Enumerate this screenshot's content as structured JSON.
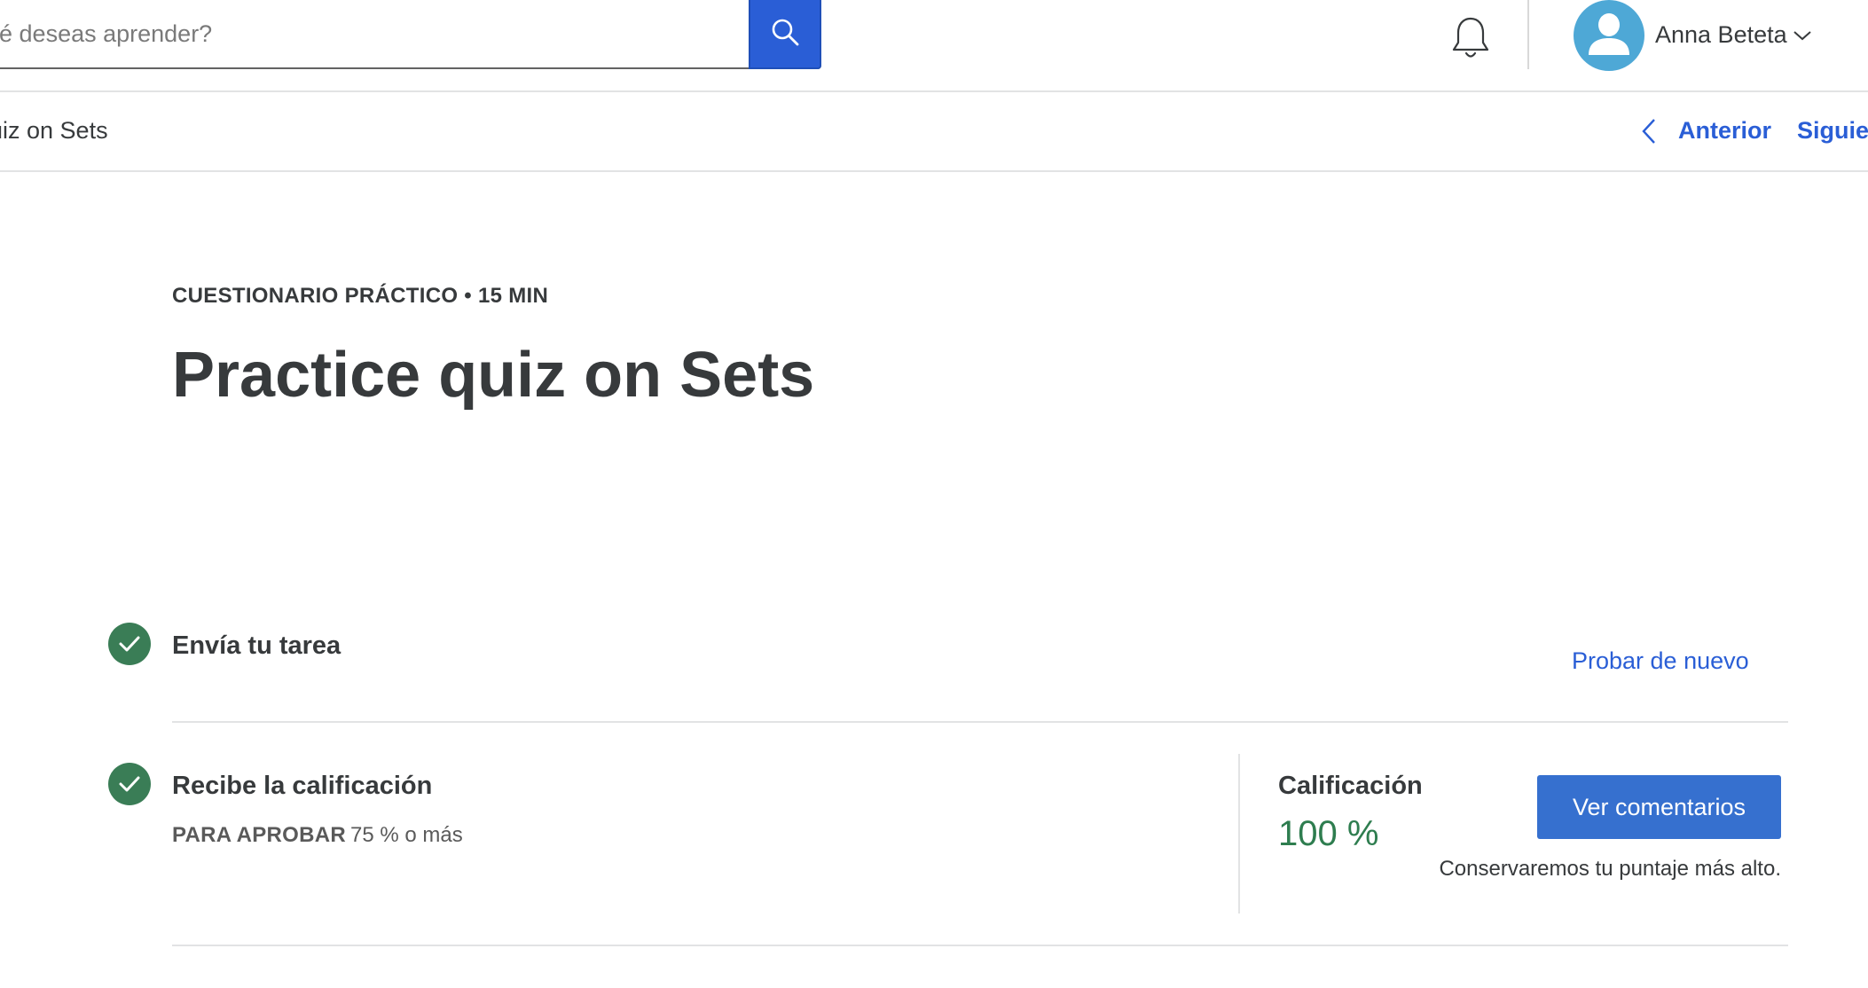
{
  "header": {
    "search": {
      "placeholder": "ué deseas aprender?"
    },
    "user": {
      "name": "Anna Beteta"
    }
  },
  "nav": {
    "breadcrumb": "uiz on Sets",
    "previous_label": "Anterior",
    "next_label": "Siguien"
  },
  "assignment": {
    "eyebrow": "CUESTIONARIO PRÁCTICO • 15 MIN",
    "title": "Practice quiz on Sets"
  },
  "steps": {
    "submit": {
      "title": "Envía tu tarea",
      "retry_label": "Probar de nuevo"
    },
    "grade": {
      "title": "Recibe la calificación",
      "pass_label": "PARA APROBAR",
      "pass_value": "75 % o más",
      "grade_label": "Calificación",
      "grade_value": "100 %",
      "feedback_button": "Ver comentarios",
      "keep_note": "Conservaremos tu puntaje más alto."
    }
  },
  "icons": {
    "search": "search-icon",
    "notifications": "bell-icon",
    "avatar": "user-avatar-icon",
    "user_menu": "chevron-down-icon",
    "previous": "chevron-left-icon",
    "completed": "check-icon"
  },
  "colors": {
    "brand_blue": "#2a5ed6",
    "button_blue": "#3670cf",
    "success_green": "#3a7d56",
    "grade_green": "#2e7d4f",
    "avatar_blue": "#4ea8d6"
  }
}
